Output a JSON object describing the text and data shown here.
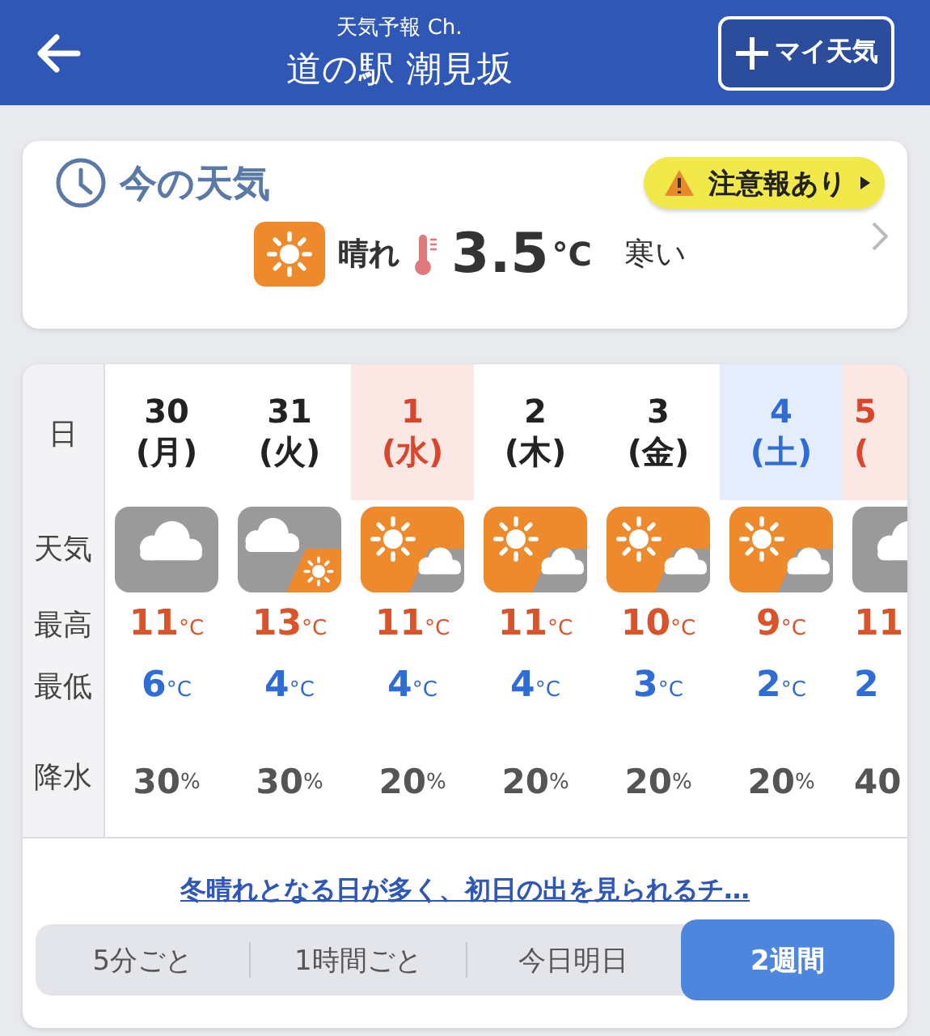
{
  "header": {
    "subtitle": "天気予報 Ch.",
    "title": "道の駅 潮見坂",
    "my_weather_button": "マイ天気"
  },
  "current": {
    "heading": "今の天気",
    "alert": "注意報あり",
    "weather": {
      "kind": "sunny"
    },
    "condition": "晴れ",
    "temperature": "3.5",
    "unit": "°C",
    "feeling": "寒い"
  },
  "forecast": {
    "row_labels": [
      "日",
      "天気",
      "最高",
      "最低",
      "降水"
    ],
    "days": [
      {
        "kind": "weekday",
        "date": "30",
        "weekday": "(月)",
        "weather": {
          "kind": "cloudy"
        },
        "high": "11",
        "high_unit": "°C",
        "low": "6",
        "low_unit": "°C",
        "precip": "30",
        "precip_unit": "%"
      },
      {
        "kind": "weekday",
        "date": "31",
        "weekday": "(火)",
        "weather": {
          "kind": "cloudy-sunny"
        },
        "high": "13",
        "high_unit": "°C",
        "low": "4",
        "low_unit": "°C",
        "precip": "30",
        "precip_unit": "%"
      },
      {
        "kind": "holiday",
        "date": "1",
        "weekday": "(水)",
        "weather": {
          "kind": "sunny-cloudy"
        },
        "high": "11",
        "high_unit": "°C",
        "low": "4",
        "low_unit": "°C",
        "precip": "20",
        "precip_unit": "%"
      },
      {
        "kind": "weekday",
        "date": "2",
        "weekday": "(木)",
        "weather": {
          "kind": "sunny-cloudy"
        },
        "high": "11",
        "high_unit": "°C",
        "low": "4",
        "low_unit": "°C",
        "precip": "20",
        "precip_unit": "%"
      },
      {
        "kind": "weekday",
        "date": "3",
        "weekday": "(金)",
        "weather": {
          "kind": "sunny-cloudy"
        },
        "high": "10",
        "high_unit": "°C",
        "low": "3",
        "low_unit": "°C",
        "precip": "20",
        "precip_unit": "%"
      },
      {
        "kind": "saturday",
        "date": "4",
        "weekday": "(土)",
        "weather": {
          "kind": "sunny-cloudy"
        },
        "high": "9",
        "high_unit": "°C",
        "low": "2",
        "low_unit": "°C",
        "precip": "20",
        "precip_unit": "%"
      },
      {
        "kind": "holiday",
        "date": "5",
        "weekday": "(",
        "weather": {
          "kind": "cloudy"
        },
        "high": "11",
        "low": "2",
        "precip": "40"
      }
    ],
    "summary_link": "冬晴れとなる日が多く、初日の出を見られるチ…"
  },
  "tabs": [
    {
      "label": "5分ごと",
      "selected": false
    },
    {
      "label": "1時間ごと",
      "selected": false
    },
    {
      "label": "今日明日",
      "selected": false
    },
    {
      "label": "2週間",
      "selected": true
    }
  ]
}
